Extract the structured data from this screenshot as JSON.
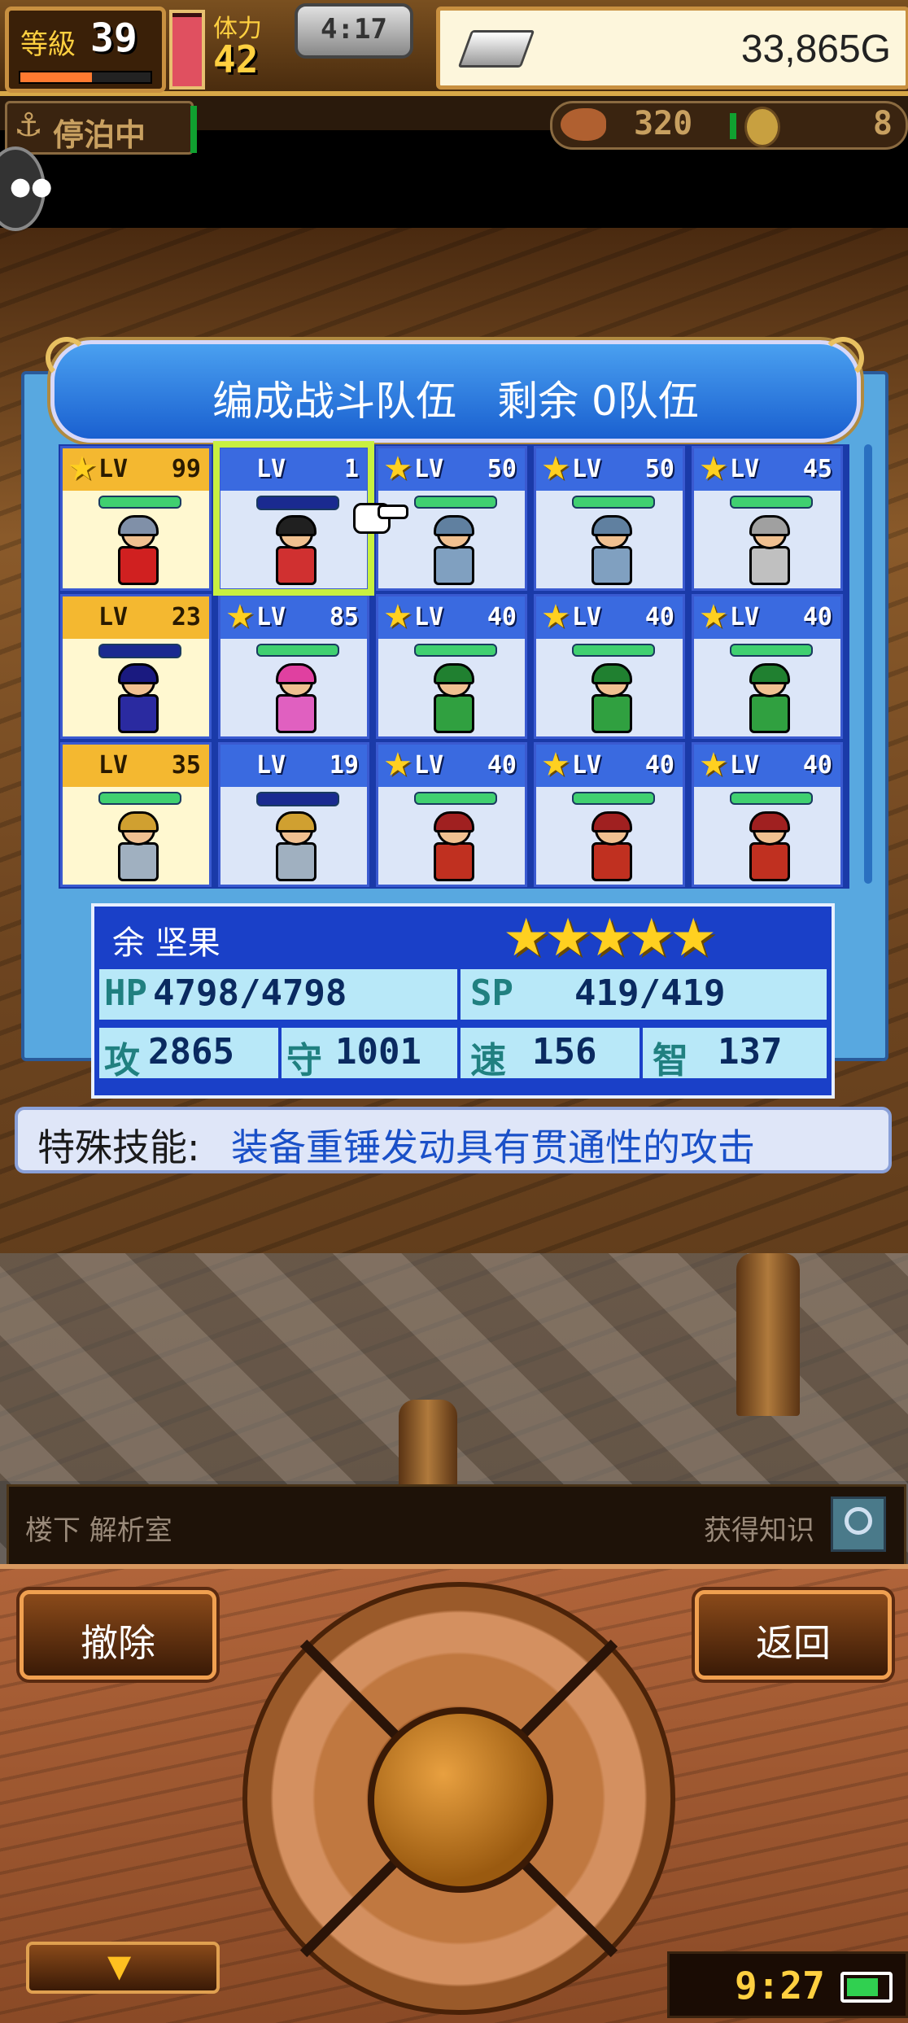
{
  "top_bar": {
    "level_label": "等級",
    "level": "39",
    "exp_fraction": 0.55,
    "hp_gauge_fraction": 0.95,
    "stamina_label": "体力",
    "stamina": "42",
    "clock": "4:17",
    "gold": "33,865G"
  },
  "status": {
    "anchor_label": "停泊中",
    "food": "320",
    "medals": "8"
  },
  "formation": {
    "title": "编成战斗队伍　剩余 0队伍",
    "lv_label": "LV",
    "units": [
      {
        "level": "99",
        "star": true,
        "gold": true,
        "hp_empty": false,
        "hair": "#8090a8",
        "body": "#d02020"
      },
      {
        "level": "1",
        "star": false,
        "gold": false,
        "hp_empty": true,
        "hair": "#202020",
        "body": "#d03030",
        "selected": true
      },
      {
        "level": "50",
        "star": true,
        "gold": false,
        "hp_empty": false,
        "hair": "#6080a0",
        "body": "#80a0c0"
      },
      {
        "level": "50",
        "star": true,
        "gold": false,
        "hp_empty": false,
        "hair": "#6080a0",
        "body": "#80a0c0"
      },
      {
        "level": "45",
        "star": true,
        "gold": false,
        "hp_empty": false,
        "hair": "#a0a0a0",
        "body": "#c0c0c0"
      },
      {
        "level": "23",
        "star": false,
        "gold": true,
        "hp_empty": true,
        "hair": "#1a1a80",
        "body": "#2a2aa0"
      },
      {
        "level": "85",
        "star": true,
        "gold": false,
        "hp_empty": false,
        "hair": "#e040a0",
        "body": "#e060c0"
      },
      {
        "level": "40",
        "star": true,
        "gold": false,
        "hp_empty": false,
        "hair": "#208030",
        "body": "#30a040"
      },
      {
        "level": "40",
        "star": true,
        "gold": false,
        "hp_empty": false,
        "hair": "#208030",
        "body": "#30a040"
      },
      {
        "level": "40",
        "star": true,
        "gold": false,
        "hp_empty": false,
        "hair": "#208030",
        "body": "#30a040"
      },
      {
        "level": "35",
        "star": false,
        "gold": true,
        "hp_empty": false,
        "hair": "#d0a030",
        "body": "#a0b0c0"
      },
      {
        "level": "19",
        "star": false,
        "gold": false,
        "hp_empty": true,
        "hair": "#d0a030",
        "body": "#a0b0c0"
      },
      {
        "level": "40",
        "star": true,
        "gold": false,
        "hp_empty": false,
        "hair": "#a02020",
        "body": "#c03020"
      },
      {
        "level": "40",
        "star": true,
        "gold": false,
        "hp_empty": false,
        "hair": "#a02020",
        "body": "#c03020"
      },
      {
        "level": "40",
        "star": true,
        "gold": false,
        "hp_empty": false,
        "hair": "#a02020",
        "body": "#c03020"
      }
    ]
  },
  "character": {
    "name": "余 坚果",
    "stars": "★★★★★",
    "hp_label": "HP",
    "hp": "4798/4798",
    "sp_label": "SP",
    "sp": "419/419",
    "atk_label": "攻",
    "atk": "2865",
    "def_label": "守",
    "def": "1001",
    "spd_label": "速",
    "spd": "156",
    "int_label": "智",
    "int": "137"
  },
  "skill": {
    "label": "特殊技能:",
    "description": "装备重锤发动具有贯通性的攻击"
  },
  "location": {
    "label": "楼下 解析室",
    "knowledge": "获得知识"
  },
  "controls": {
    "remove_label": "撤除",
    "back_label": "返回",
    "system_time": "9:27"
  },
  "colors": {
    "panel": "#58a8e0",
    "title_bar": "#1a60d0",
    "selected_outline": "#c8f040",
    "skill_text": "#1a50c8"
  }
}
